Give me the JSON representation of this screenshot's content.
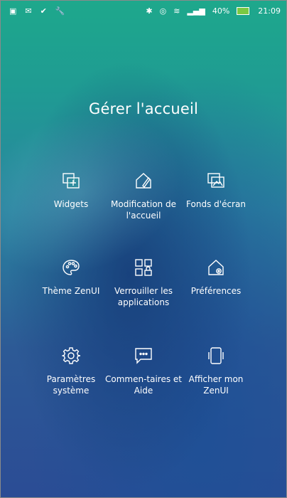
{
  "status_bar": {
    "battery": "40%",
    "time": "21:09"
  },
  "page": {
    "title": "Gérer l'accueil"
  },
  "menu": {
    "items": [
      {
        "label": "Widgets",
        "icon": "widgets-icon"
      },
      {
        "label": "Modification de l'accueil",
        "icon": "edit-home-icon"
      },
      {
        "label": "Fonds d'écran",
        "icon": "wallpaper-icon"
      },
      {
        "label": "Thème ZenUI",
        "icon": "palette-icon"
      },
      {
        "label": "Verrouiller les applications",
        "icon": "app-lock-icon"
      },
      {
        "label": "Préférences",
        "icon": "home-settings-icon"
      },
      {
        "label": "Paramètres système",
        "icon": "gear-icon"
      },
      {
        "label": "Commen-taires et Aide",
        "icon": "chat-icon"
      },
      {
        "label": "Afficher mon ZenUI",
        "icon": "phone-icon"
      }
    ]
  }
}
